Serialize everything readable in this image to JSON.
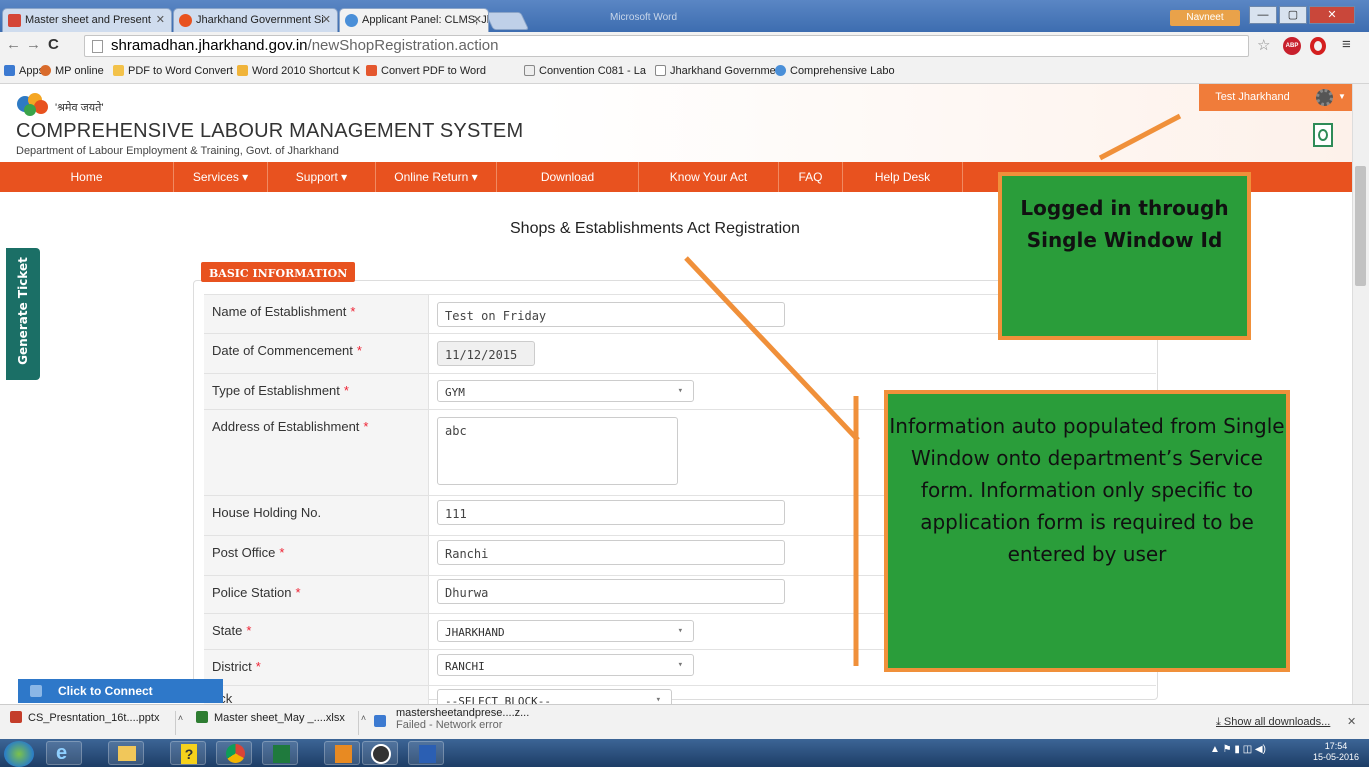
{
  "browser": {
    "tabs": [
      {
        "label": "Master sheet and Present",
        "icon_color": "#d44638"
      },
      {
        "label": "Jharkhand Government Si",
        "icon_color": "#e8521f"
      },
      {
        "label": "Applicant Panel: CLMS, Jh",
        "icon_color": "#4a8fd8"
      }
    ],
    "window_title": "Microsoft Word",
    "user_chip": "Navneet",
    "url_host": "shramadhan.jharkhand.gov.in",
    "url_path": "/newShopRegistration.action",
    "bookmarks": [
      "Apps",
      "MP online",
      "PDF to Word Convert",
      "Word 2010 Shortcut K",
      "Convert PDF to Word",
      "Convention C081 - La",
      "Jharkhand Governme",
      "Comprehensive Labo"
    ]
  },
  "site": {
    "tagline": "'श्रमेव जयते'",
    "title": "COMPREHENSIVE LABOUR MANAGEMENT SYSTEM",
    "department": "Department of Labour Employment & Training, Govt. of Jharkhand",
    "user_name": "Test Jharkhand",
    "nav": [
      "Home",
      "Services ▾",
      "Support ▾",
      "Online Return ▾",
      "Download",
      "Know Your Act",
      "FAQ",
      "Help Desk"
    ]
  },
  "page": {
    "title": "Shops & Establishments Act Registration",
    "section_label": "BASIC INFORMATION",
    "generate_ticket": "Generate Ticket",
    "click_to_connect": "Click to Connect"
  },
  "form": {
    "name_label": "Name of Establishment",
    "name_value": "Test on Friday",
    "date_label": "Date of Commencement",
    "date_value": "11/12/2015",
    "type_label": "Type of Establishment",
    "type_value": "GYM",
    "address_label": "Address of Establishment",
    "address_value": "abc",
    "house_label": "House Holding No.",
    "house_value": "111",
    "post_label": "Post Office",
    "post_value": "Ranchi",
    "police_label": "Police Station",
    "police_value": "Dhurwa",
    "state_label": "State",
    "state_value": "JHARKHAND",
    "district_label": "District",
    "district_value": "RANCHI",
    "block_label": "ock",
    "block_value": "--SELECT BLOCK--",
    "required_mark": "*"
  },
  "callouts": {
    "login": "Logged in through Single Window Id",
    "autofill": "Information auto populated from Single Window onto department’s Service form. Information only specific to application form is required to be entered by user"
  },
  "downloads": {
    "items": [
      "CS_Presntation_16t....pptx",
      "Master sheet_May _....xlsx",
      "mastersheetandprese....z..."
    ],
    "status": "Failed - Network error",
    "show_all": "Show all downloads..."
  },
  "taskbar": {
    "time": "17:54",
    "date": "15-05-2016"
  },
  "colors": {
    "accent_orange": "#e8521f",
    "callout_green": "#2a9d3a",
    "callout_border": "#f0903a"
  }
}
